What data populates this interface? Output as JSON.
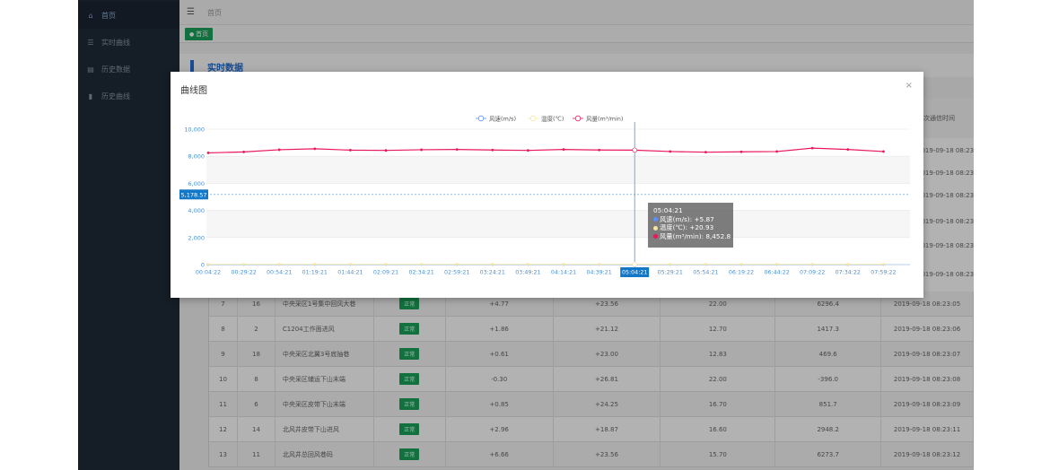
{
  "sidebar": {
    "items": [
      {
        "icon": "home-icon",
        "label": "首页",
        "active": true
      },
      {
        "icon": "list-icon",
        "label": "实时曲线"
      },
      {
        "icon": "file-icon",
        "label": "历史数据"
      },
      {
        "icon": "bar-chart-icon",
        "label": "历史曲线"
      }
    ]
  },
  "header": {
    "breadcrumb": "首页"
  },
  "tabs": [
    {
      "label": "首页"
    }
  ],
  "section": {
    "title": "实时数据"
  },
  "table": {
    "last_header": "本次通信时间",
    "partial_times": [
      "2019-09-18 08:23:16",
      "2019-09-18 08:23:17",
      "2019-09-18 08:23:18",
      "2019-09-18 08:23:19",
      "2019-09-18 08:23:20",
      "2019-09-18 08:23:21"
    ],
    "rows": [
      {
        "index": "7",
        "id": "16",
        "name": "中央采区1号集中回风大巷",
        "status": "正常",
        "speed": "+4.77",
        "temp": "+23.56",
        "area": "22.00",
        "volume": "6296.4",
        "time": "2019-09-18 08:23:05"
      },
      {
        "index": "8",
        "id": "2",
        "name": "C1204工作面进风",
        "status": "正常",
        "speed": "+1.86",
        "temp": "+21.12",
        "area": "12.70",
        "volume": "1417.3",
        "time": "2019-09-18 08:23:06"
      },
      {
        "index": "9",
        "id": "18",
        "name": "中央采区北翼3号底抽巷",
        "status": "正常",
        "speed": "+0.61",
        "temp": "+23.00",
        "area": "12.83",
        "volume": "469.6",
        "time": "2019-09-18 08:23:07"
      },
      {
        "index": "10",
        "id": "8",
        "name": "中央采区辅运下山末端",
        "status": "正常",
        "speed": "-0.30",
        "temp": "+26.81",
        "area": "22.00",
        "volume": "-396.0",
        "time": "2019-09-18 08:23:08"
      },
      {
        "index": "11",
        "id": "6",
        "name": "中央采区皮带下山末端",
        "status": "正常",
        "speed": "+0.85",
        "temp": "+24.25",
        "area": "16.70",
        "volume": "851.7",
        "time": "2019-09-18 08:23:09"
      },
      {
        "index": "12",
        "id": "14",
        "name": "北风井皮带下山进风",
        "status": "正常",
        "speed": "+2.96",
        "temp": "+18.87",
        "area": "16.60",
        "volume": "2948.2",
        "time": "2019-09-18 08:23:11"
      },
      {
        "index": "13",
        "id": "11",
        "name": "北风井总回风巷码",
        "status": "正常",
        "speed": "+6.66",
        "temp": "+23.56",
        "area": "15.70",
        "volume": "6273.7",
        "time": "2019-09-18 08:23:12"
      }
    ]
  },
  "modal": {
    "title": "曲线图",
    "close": "×"
  },
  "tooltip": {
    "time": "05:04:21",
    "rows": [
      {
        "label": "风速(m/s): +5.87",
        "color": "#5b8ff9"
      },
      {
        "label": "温度(℃): +20.93",
        "color": "#f5e6a0"
      },
      {
        "label": "风量(m³/min): 8,452.8",
        "color": "#e8185a"
      }
    ]
  },
  "chart_data": {
    "type": "line",
    "legend_position": "top-center",
    "ylim": [
      0,
      10000
    ],
    "y_ticks": [
      "0",
      "2,000",
      "4,000",
      "6,000",
      "8,000",
      "10,000"
    ],
    "x_ticks": [
      "00:04:22",
      "00:29:22",
      "00:54:21",
      "01:19:21",
      "01:44:21",
      "02:09:21",
      "02:34:21",
      "02:59:21",
      "03:24:21",
      "03:49:21",
      "04:14:21",
      "04:39:21",
      "05:04:21",
      "05:29:21",
      "05:54:21",
      "06:19:22",
      "06:44:22",
      "07:09:22",
      "07:34:22",
      "07:59:22"
    ],
    "crosshair_x": "05:04:21",
    "crosshair_y_label": "5,178.57",
    "crosshair_y_value": 5178.57,
    "series": [
      {
        "name": "风速(m/s)",
        "color": "#5b8ff9",
        "values": [
          5.9,
          5.9,
          5.9,
          5.9,
          5.9,
          5.9,
          5.9,
          5.9,
          5.9,
          5.9,
          5.9,
          5.9,
          5.87,
          5.9,
          5.9,
          5.9,
          5.9,
          5.9,
          5.9,
          5.9
        ]
      },
      {
        "name": "温度(℃)",
        "color": "#f5e6a0",
        "values": [
          20.9,
          20.9,
          20.9,
          20.9,
          20.9,
          20.9,
          20.9,
          20.9,
          20.9,
          20.9,
          20.9,
          20.9,
          20.93,
          20.9,
          20.9,
          20.9,
          20.9,
          20.9,
          20.9,
          20.9
        ]
      },
      {
        "name": "风量(m³/min)",
        "color": "#e8185a",
        "values": [
          8250,
          8320,
          8480,
          8550,
          8450,
          8430,
          8480,
          8500,
          8460,
          8430,
          8500,
          8460,
          8452.8,
          8350,
          8300,
          8330,
          8350,
          8600,
          8500,
          8350
        ]
      }
    ]
  }
}
